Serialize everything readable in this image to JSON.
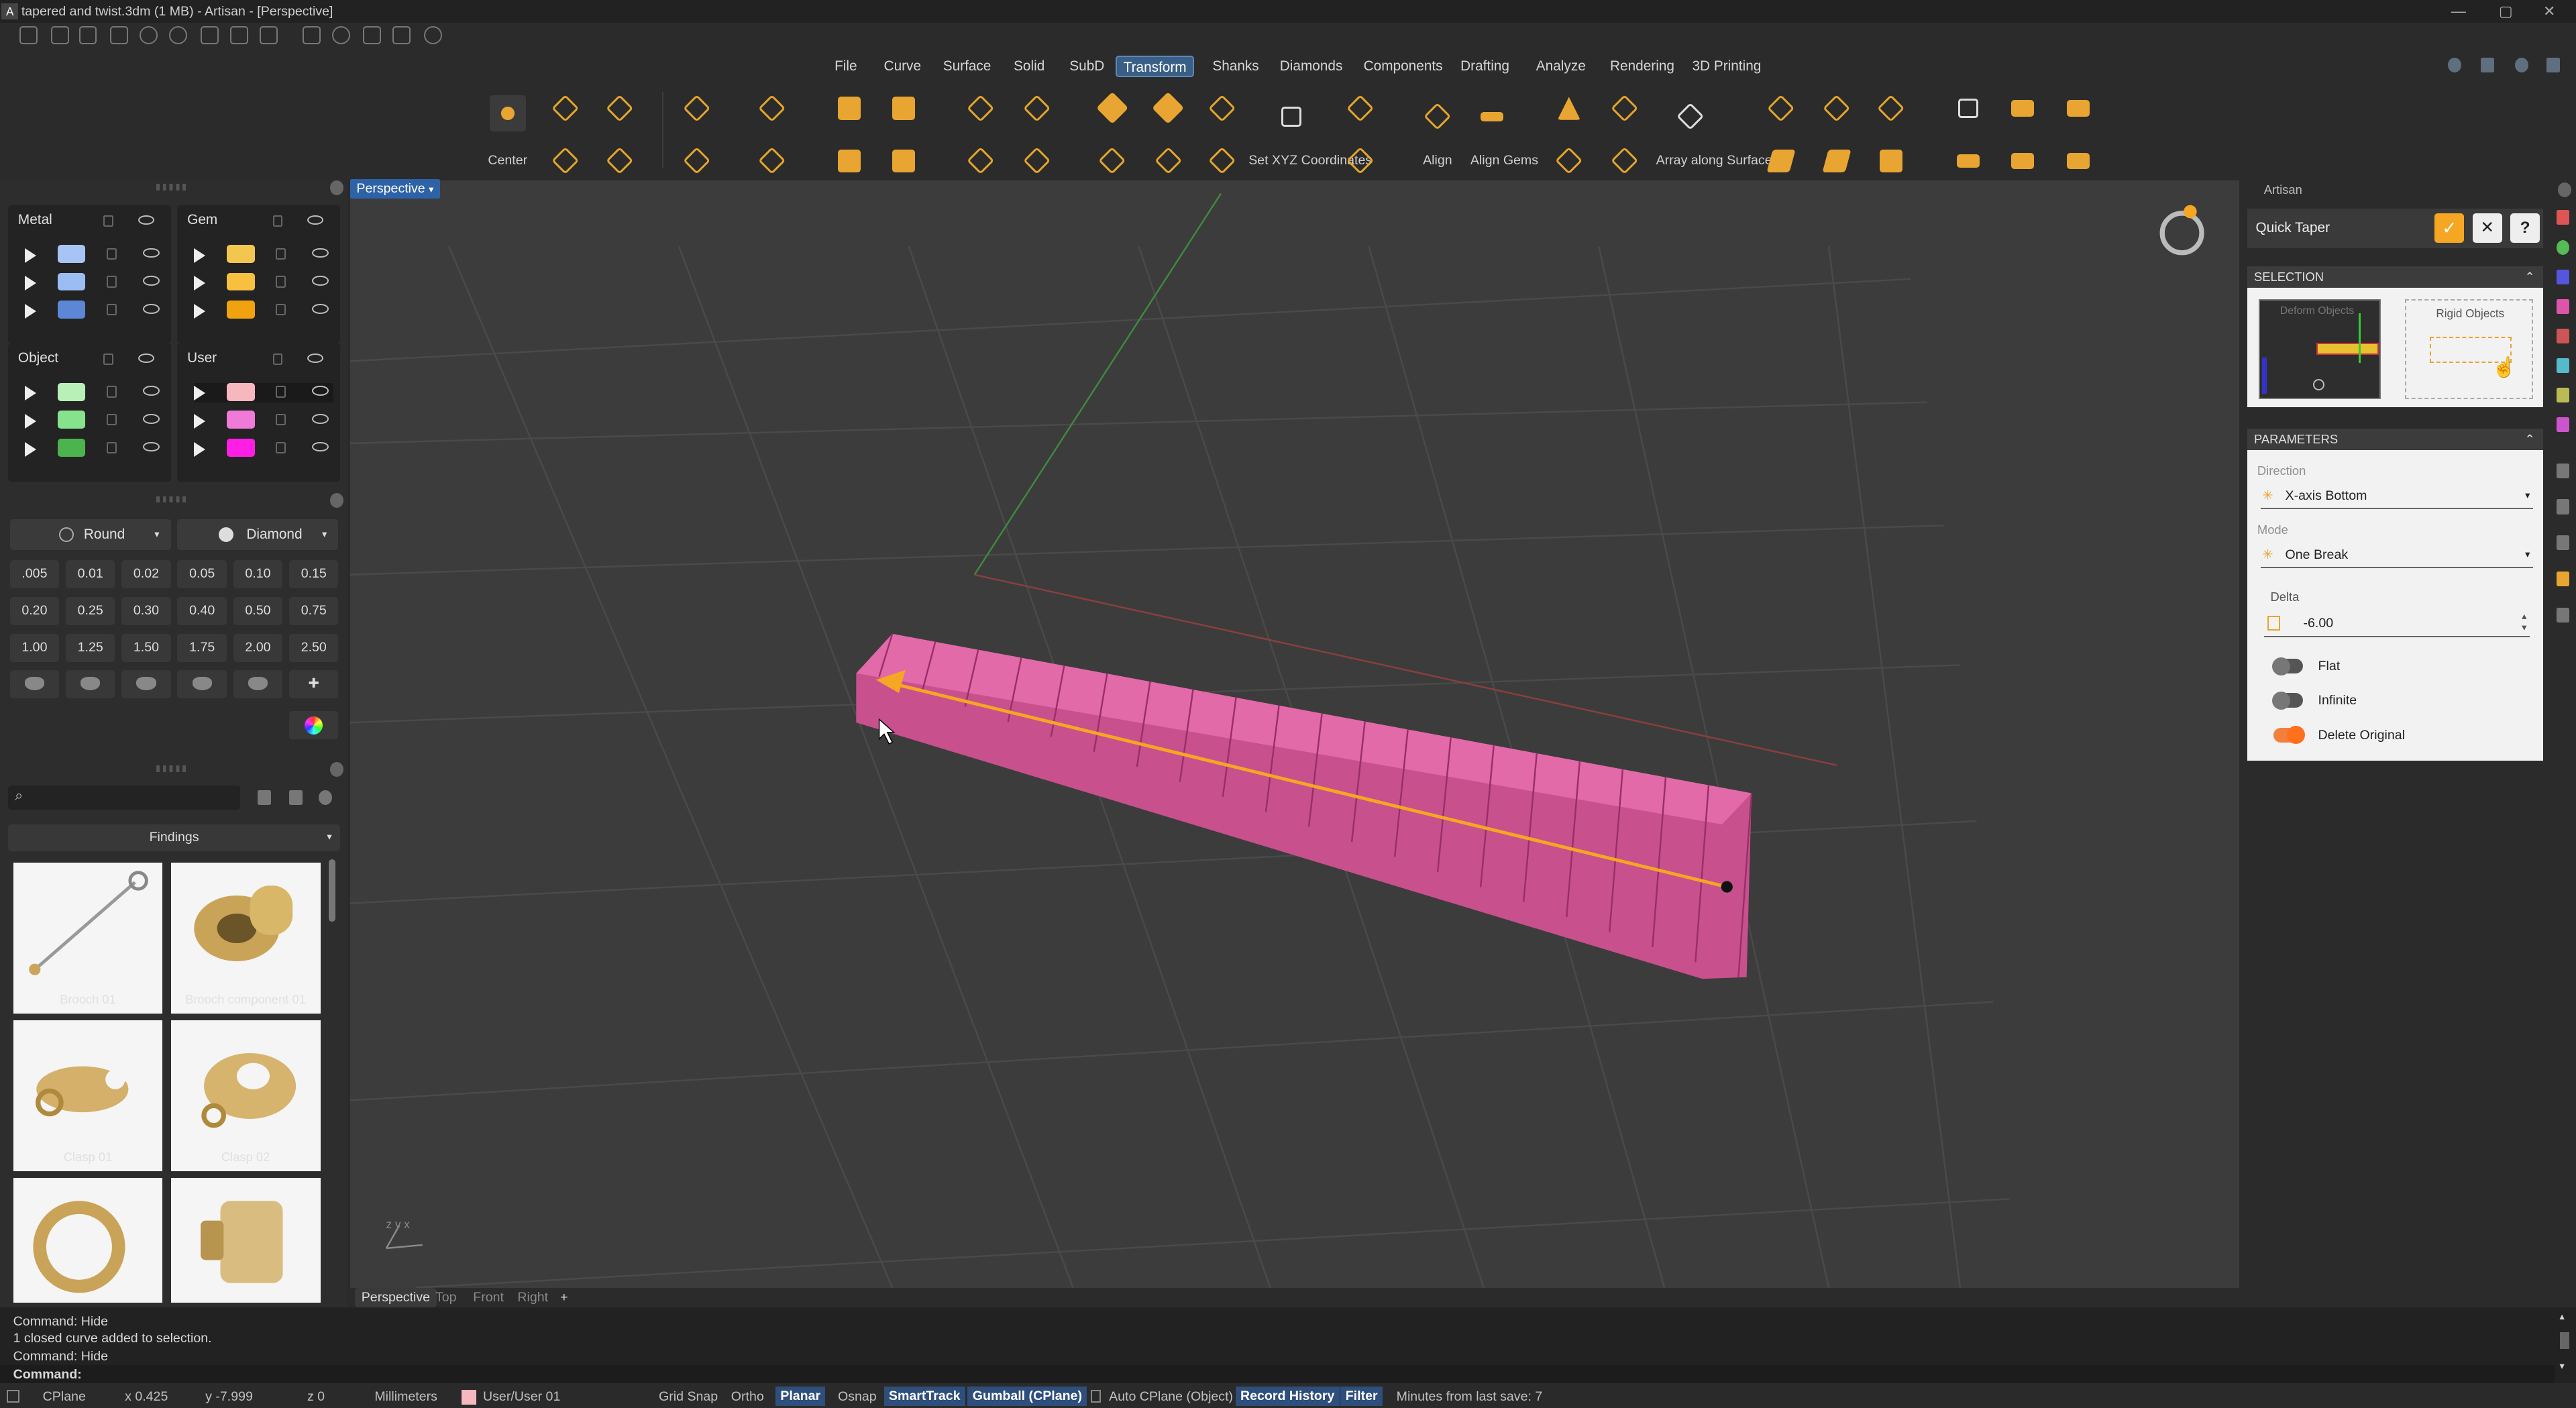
{
  "window": {
    "title": "tapered and twist.3dm (1 MB) - Artisan - [Perspective]"
  },
  "menu": [
    "File",
    "Curve",
    "Surface",
    "Solid",
    "SubD",
    "Transform",
    "Shanks",
    "Diamonds",
    "Components",
    "Drafting",
    "Analyze",
    "Rendering",
    "3D Printing"
  ],
  "menu_active": "Transform",
  "ribbon": {
    "center": "Center",
    "set_xyz": "Set XYZ Coordinates",
    "align": "Align",
    "align_gems": "Align Gems",
    "array_along_surface": "Array along Surface"
  },
  "layers": {
    "metal": "Metal",
    "gem": "Gem",
    "object": "Object",
    "user": "User",
    "colors": {
      "metal": [
        "#a7c4f5",
        "#9bbdf3",
        "#5b87d6"
      ],
      "gem": [
        "#f2c64f",
        "#f7c03e",
        "#f0a20f"
      ],
      "object": [
        "#b8f0b8",
        "#86e28c",
        "#4cb44f"
      ],
      "user": [
        "#f7b7be",
        "#f07ad8",
        "#ff1fe4"
      ]
    }
  },
  "gems": {
    "shape": "Round",
    "cut": "Diamond",
    "sizes": [
      ".005",
      "0.01",
      "0.02",
      "0.05",
      "0.10",
      "0.15",
      "0.20",
      "0.25",
      "0.30",
      "0.40",
      "0.50",
      "0.75",
      "1.00",
      "1.25",
      "1.50",
      "1.75",
      "2.00",
      "2.50"
    ]
  },
  "library": {
    "search_placeholder": "",
    "category": "Findings",
    "items": [
      "Brooch 01",
      "Brooch component 01",
      "Clasp 01",
      "Clasp 02"
    ]
  },
  "viewport": {
    "name": "Perspective",
    "tabs": [
      "Perspective",
      "Top",
      "Front",
      "Right"
    ],
    "active_tab": "Perspective",
    "add_tab": "+",
    "axes_label": "z y x"
  },
  "artisan": {
    "header": "Artisan",
    "command": "Quick Taper",
    "selection_title": "SELECTION",
    "deform_objects": "Deform Objects",
    "rigid_objects": "Rigid Objects",
    "parameters_title": "PARAMETERS",
    "direction_label": "Direction",
    "direction_value": "X-axis Bottom",
    "mode_label": "Mode",
    "mode_value": "One Break",
    "delta_label": "Delta",
    "delta_value": "-6.00",
    "flat": {
      "label": "Flat",
      "on": false
    },
    "infinite": {
      "label": "Infinite",
      "on": false
    },
    "delete_original": {
      "label": "Delete Original",
      "on": true
    }
  },
  "command_history": [
    "Command: Hide",
    "1 closed curve added to selection.",
    "Command: Hide"
  ],
  "command_prompt": "Command:",
  "status": {
    "cplane": "CPlane",
    "x": "x 0.425",
    "y": "y -7.999",
    "z": "z 0",
    "units": "Millimeters",
    "layer": "User/User 01",
    "grid_snap": "Grid Snap",
    "ortho": "Ortho",
    "planar": "Planar",
    "osnap": "Osnap",
    "smarttrack": "SmartTrack",
    "gumball": "Gumball (CPlane)",
    "auto_cplane": "Auto CPlane (Object)",
    "record_history": "Record History",
    "filter": "Filter",
    "last_save": "Minutes from last save: 7"
  },
  "colors": {
    "accent": "#f5a623",
    "object": "#e35aa0",
    "selection_blue": "#2e62a7"
  }
}
